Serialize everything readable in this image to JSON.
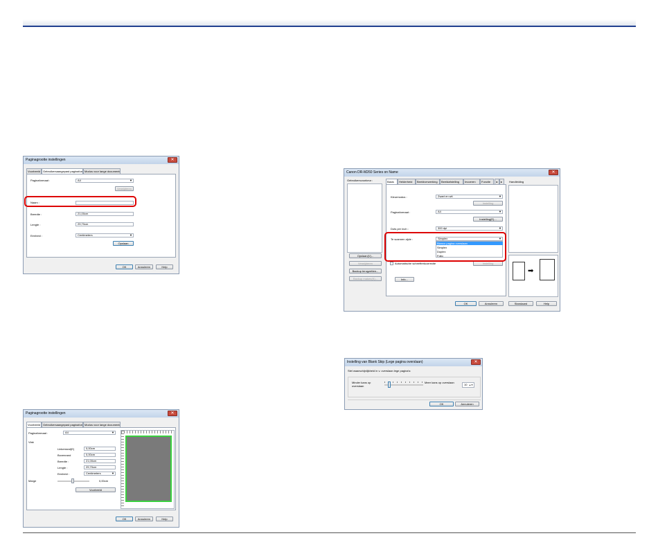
{
  "dialog1": {
    "title": "Paginagrootte instellingen",
    "tabs": [
      "Voorbeeld",
      "Gebruikersaangepast paginaformaat",
      "Modus voor lange documenten"
    ],
    "paginaformaat_label": "Paginaformaat :",
    "paginaformaat_value": "A4",
    "verwijderen": "Verwijderen",
    "naam_label": "Naam :",
    "breedte_label": "Breedte :",
    "breedte_value": "21,00cm",
    "lengte_label": "Lengte :",
    "lengte_value": "29,70cm",
    "eenheid_label": "Eenheid :",
    "eenheid_value": "Centimeters",
    "opslaan": "Opslaan",
    "ok": "OK",
    "annuleren": "Annuleren",
    "help": "Help"
  },
  "dialog2": {
    "title": "Paginagrootte instellingen",
    "tabs": [
      "Voorbeeld",
      "Gebruikersaangepast paginaformaat",
      "Modus voor lange documenten"
    ],
    "paginaformaat_label": "Paginaformaat :",
    "paginaformaat_value": "A4",
    "vlak_label": "Vlak",
    "fields": [
      {
        "label": "Linkerrand(E)",
        "value": "0,00cm"
      },
      {
        "label": "Bovenrand",
        "value": "0,00cm"
      },
      {
        "label": "Breedte :",
        "value": "21,00cm"
      },
      {
        "label": "Lengte :",
        "value": "29,70cm"
      },
      {
        "label": "Eenheid :",
        "value": "Centimeters"
      }
    ],
    "marge_label": "Marge",
    "marge_value": "0,00cm",
    "voorbeeld_button": "Voorbeeld",
    "ok": "OK",
    "annuleren": "Annuleren",
    "help": "Help"
  },
  "dialog3": {
    "title": "Canon DR-M260 Series on Name",
    "gebruikersvoorkeur": "Gebruikersvoorkeur :",
    "tabs": [
      "Basis",
      "Helderheid",
      "Beeldverwerking",
      "Beeldafstelling",
      "Invoeren",
      "Functie"
    ],
    "handleiding": "Handleiding",
    "kleurmodus_label": "Kleurmodus :",
    "kleurmodus_value": "Zwart en wit",
    "instelling": "Instelling",
    "paginaformaat_label": "Paginaformaat :",
    "paginaformaat_value": "A4",
    "instelling_e": "Instelling(E)...",
    "dpi_label": "Dots per inch :",
    "dpi_value": "300 dpi",
    "zijde_label": "Te scannen zijde :",
    "zijde_value": "Simplex",
    "options": [
      "Blanco pagina overslaan",
      "Simplex",
      "Duplex",
      "Folio"
    ],
    "opslaan": "Opslaan(V)...",
    "verwijderen": "Verwijderen",
    "backup_terug": "Backup terugzetten...",
    "backup_maken": "Backup maken(K)...",
    "scheefstand": "Automatische scheeftrekcorrectie",
    "instelling2": "Instelling",
    "info": "Info...",
    "ok": "OK",
    "annuleren": "Annuleren",
    "standaard": "Standaard",
    "help": "Help"
  },
  "dialog4": {
    "title": "Instelling van Blank Skip (Lege pagina overslaan)",
    "prompt": "Stel waarschijnlijkheid in v. overslaan lege pagina's:",
    "left_label": "Minder kans op overslaan",
    "right_label": "Meer kans op overslaan",
    "value": "10",
    "level_fraction": 0.1,
    "ok": "OK",
    "annuleren": "Annuleren"
  }
}
